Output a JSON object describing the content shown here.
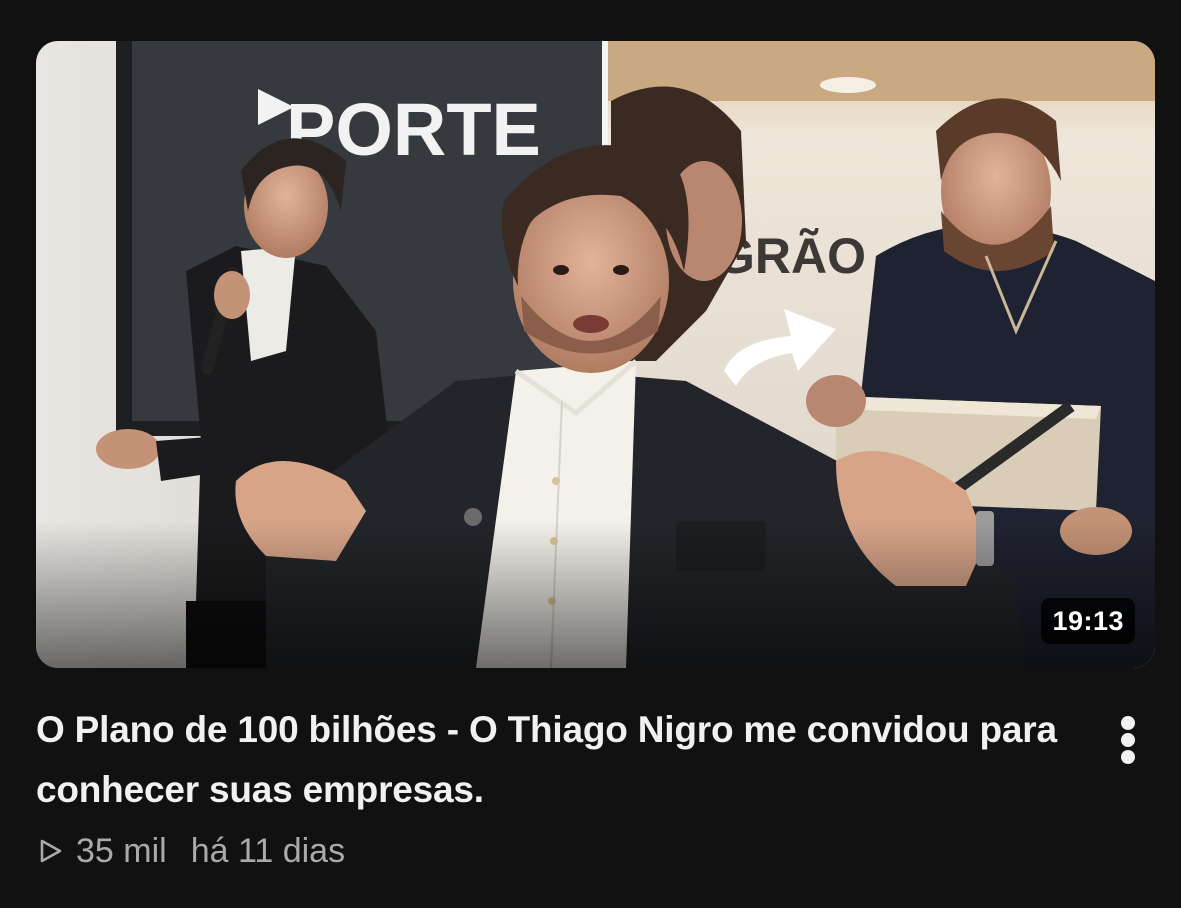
{
  "video": {
    "duration": "19:13",
    "title": "O Plano de 100 bilhões - O Thiago Nigro me convidou para conhecer suas empresas.",
    "views": "35 mil",
    "uploaded": "há 11 dias"
  },
  "thumbnail": {
    "sign_left": "PORTE",
    "sign_right": "GRÃO"
  },
  "icons": {
    "menu": "more-vertical-icon",
    "views": "play-outline-icon"
  },
  "colors": {
    "background": "#111111",
    "title": "#f1f1f1",
    "meta": "#aaaaaa",
    "duration_badge": "#000000"
  }
}
